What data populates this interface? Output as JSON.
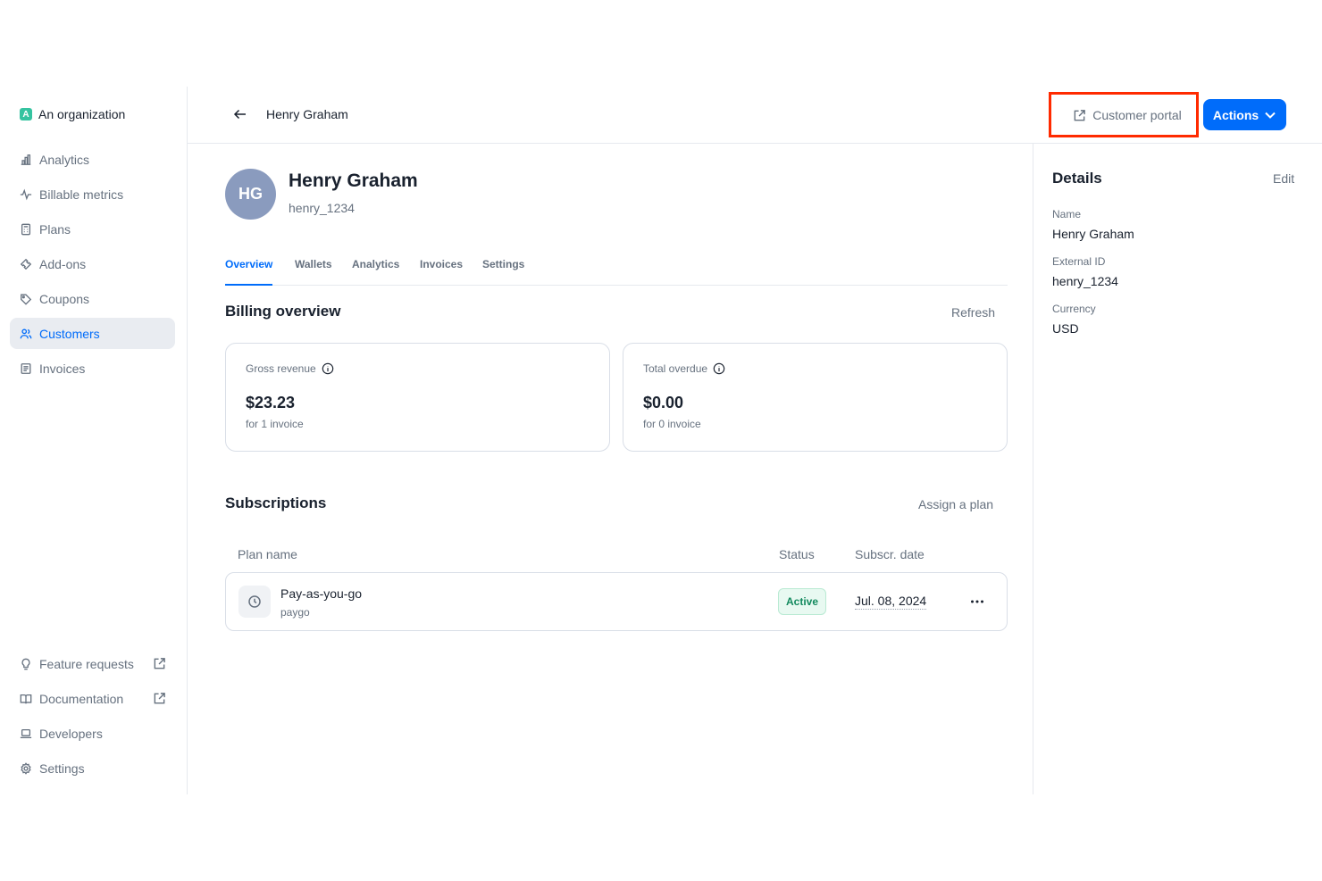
{
  "sidebar": {
    "org_name": "An organization",
    "org_initial": "A",
    "items": [
      {
        "label": "Analytics",
        "icon": "chart-bar-icon"
      },
      {
        "label": "Billable metrics",
        "icon": "pulse-icon"
      },
      {
        "label": "Plans",
        "icon": "calculator-icon"
      },
      {
        "label": "Add-ons",
        "icon": "puzzle-icon"
      },
      {
        "label": "Coupons",
        "icon": "tag-icon"
      },
      {
        "label": "Customers",
        "icon": "users-icon",
        "active": true
      },
      {
        "label": "Invoices",
        "icon": "document-icon"
      }
    ],
    "bottom_items": [
      {
        "label": "Feature requests",
        "icon": "lightbulb-icon",
        "external": true
      },
      {
        "label": "Documentation",
        "icon": "book-icon",
        "external": true
      },
      {
        "label": "Developers",
        "icon": "laptop-icon"
      },
      {
        "label": "Settings",
        "icon": "gear-icon"
      }
    ]
  },
  "topbar": {
    "title": "Henry Graham",
    "customer_portal_label": "Customer portal",
    "actions_label": "Actions"
  },
  "customer": {
    "initials": "HG",
    "name": "Henry Graham",
    "external_id": "henry_1234"
  },
  "tabs": [
    "Overview",
    "Wallets",
    "Analytics",
    "Invoices",
    "Settings"
  ],
  "active_tab": "Overview",
  "billing": {
    "title": "Billing overview",
    "refresh_label": "Refresh",
    "cards": [
      {
        "label": "Gross revenue",
        "value": "$23.23",
        "sub": "for 1 invoice"
      },
      {
        "label": "Total overdue",
        "value": "$0.00",
        "sub": "for 0 invoice"
      }
    ]
  },
  "subscriptions": {
    "title": "Subscriptions",
    "assign_label": "Assign a plan",
    "columns": [
      "Plan name",
      "Status",
      "Subscr. date"
    ],
    "rows": [
      {
        "plan_name": "Pay-as-you-go",
        "plan_code": "paygo",
        "status": "Active",
        "date": "Jul. 08, 2024"
      }
    ]
  },
  "details": {
    "title": "Details",
    "edit_label": "Edit",
    "fields": [
      {
        "label": "Name",
        "value": "Henry Graham"
      },
      {
        "label": "External ID",
        "value": "henry_1234"
      },
      {
        "label": "Currency",
        "value": "USD"
      }
    ]
  },
  "colors": {
    "accent": "#006cfa",
    "highlight": "#ff2a00",
    "active_badge": "#138a5e"
  }
}
